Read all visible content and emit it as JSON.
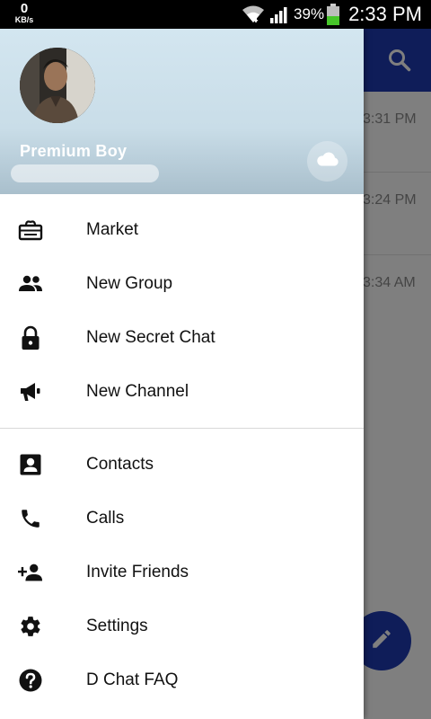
{
  "status_bar": {
    "speed_value": "0",
    "speed_unit": "KB/s",
    "battery_percent": "39%",
    "time": "2:33 PM",
    "icons": [
      "wifi-icon",
      "signal-icon",
      "battery-icon"
    ]
  },
  "background_chats": {
    "times": [
      "3:31 PM",
      "3:24 PM",
      "3:34 AM"
    ]
  },
  "drawer": {
    "user_name": "Premium Boy",
    "user_phone": "",
    "cloud_icon": "cloud-icon",
    "menu_group_1": [
      {
        "label": "Market",
        "icon": "store-icon"
      },
      {
        "label": "New Group",
        "icon": "group-icon"
      },
      {
        "label": "New Secret Chat",
        "icon": "lock-icon"
      },
      {
        "label": "New Channel",
        "icon": "megaphone-icon"
      }
    ],
    "menu_group_2": [
      {
        "label": "Contacts",
        "icon": "contact-icon"
      },
      {
        "label": "Calls",
        "icon": "phone-icon"
      },
      {
        "label": "Invite Friends",
        "icon": "person-add-icon"
      },
      {
        "label": "Settings",
        "icon": "gear-icon"
      },
      {
        "label": "D Chat FAQ",
        "icon": "help-icon"
      }
    ]
  },
  "colors": {
    "toolbar": "#1e3bb3",
    "header_gradient_top": "#d3e6f0",
    "header_gradient_bottom": "#a9bfcc"
  }
}
